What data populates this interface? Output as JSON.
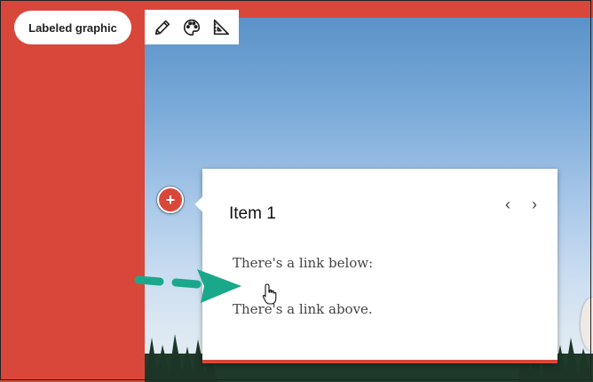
{
  "label_pill": {
    "text": "Labeled graphic"
  },
  "toolbar": {
    "tools": [
      {
        "icon": "pencil-icon"
      },
      {
        "icon": "palette-icon"
      },
      {
        "icon": "set-square-icon"
      }
    ]
  },
  "hotspot": {
    "symbol": "+"
  },
  "card": {
    "title": "Item 1",
    "prev_symbol": "‹",
    "next_symbol": "›",
    "paragraphs": [
      "There's a link below:",
      "There's a link above."
    ]
  },
  "colors": {
    "accent": "#d9473a",
    "annotation_arrow": "#1aa88a"
  }
}
